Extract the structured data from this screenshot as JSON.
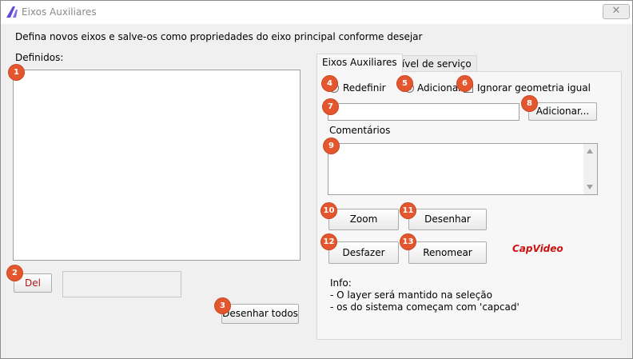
{
  "window": {
    "title": "Eixos Auxiliares",
    "close_glyph": "✕"
  },
  "description": "Defina novos eixos e salve-os como propriedades do eixo principal conforme desejar",
  "defined_label": "Definidos:",
  "left": {
    "del_label": "Del",
    "del_color": "#b01818",
    "draw_all_label": "Desenhar todos"
  },
  "tabs": [
    {
      "label": "Eixos Auxiliares"
    },
    {
      "label": "Nível de serviço"
    }
  ],
  "options": {
    "redefine_label": "Redefinir",
    "add_label": "Adicionar",
    "ignore_label": "Ignorar geometria igual",
    "selected": "Adicionar"
  },
  "name_input": {
    "value": "",
    "placeholder": ""
  },
  "add_button_label": "Adicionar...",
  "comments_label": "Comentários",
  "buttons": {
    "zoom": "Zoom",
    "draw": "Desenhar",
    "undo": "Desfazer",
    "rename": "Renomear"
  },
  "watermark": {
    "text": "CapVideo",
    "color": "#cc1111"
  },
  "info": {
    "title": "Info:",
    "lines": [
      "- O layer será mantido na seleção",
      "- os do sistema começam com 'capcad'"
    ]
  },
  "badges": [
    "1",
    "2",
    "3",
    "4",
    "5",
    "6",
    "7",
    "8",
    "9",
    "10",
    "11",
    "12",
    "13"
  ],
  "badge_color": "#e4572e"
}
